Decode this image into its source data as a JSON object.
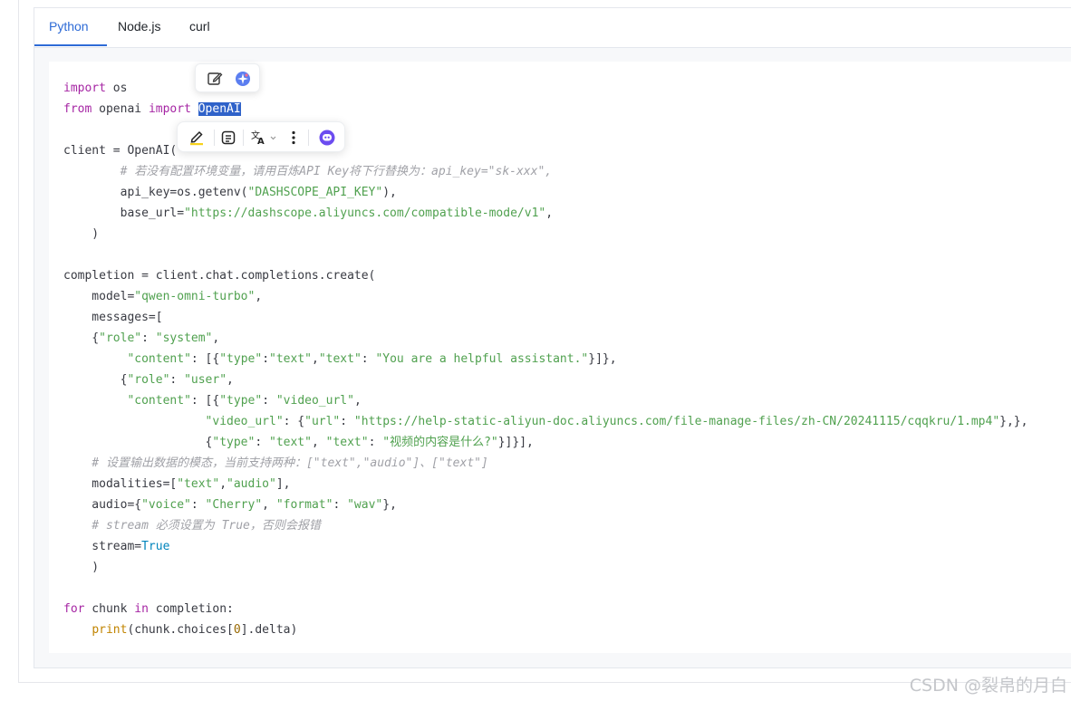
{
  "tabs": [
    {
      "label": "Python",
      "active": true
    },
    {
      "label": "Node.js",
      "active": false
    },
    {
      "label": "curl",
      "active": false
    }
  ],
  "code": {
    "l1_kw": "import",
    "l1_rest": " os",
    "l2_kw1": "from",
    "l2_mid": " openai ",
    "l2_kw2": "import",
    "l2_sp": " ",
    "l2_sel": "OpenAI",
    "l4": "client = OpenAI(",
    "l5_comment": "        # 若没有配置环境变量，请用百炼API Key将下行替换为：api_key=\"sk-xxx\",",
    "l6_pre": "        api_key=os.getenv(",
    "l6_str": "\"DASHSCOPE_API_KEY\"",
    "l6_post": "),",
    "l7_pre": "        base_url=",
    "l7_str": "\"https://dashscope.aliyuncs.com/compatible-mode/v1\"",
    "l7_post": ",",
    "l8": "    )",
    "l10": "completion = client.chat.completions.create(",
    "l11_pre": "    model=",
    "l11_str": "\"qwen-omni-turbo\"",
    "l11_post": ",",
    "l12": "    messages=[",
    "l13_pre": "    {",
    "l13_k": "\"role\"",
    "l13_mid": ": ",
    "l13_v": "\"system\"",
    "l13_post": ",",
    "l14_pre": "         ",
    "l14_k": "\"content\"",
    "l14_a": ": [{",
    "l14_t1": "\"type\"",
    "l14_b": ":",
    "l14_t2": "\"text\"",
    "l14_c": ",",
    "l14_t3": "\"text\"",
    "l14_d": ": ",
    "l14_t4": "\"You are a helpful assistant.\"",
    "l14_e": "}]},",
    "l15_pre": "        {",
    "l15_k": "\"role\"",
    "l15_mid": ": ",
    "l15_v": "\"user\"",
    "l15_post": ",",
    "l16_pre": "         ",
    "l16_k": "\"content\"",
    "l16_a": ": [{",
    "l16_t1": "\"type\"",
    "l16_b": ": ",
    "l16_t2": "\"video_url\"",
    "l16_c": ",",
    "l17_pre": "                    ",
    "l17_k": "\"video_url\"",
    "l17_a": ": {",
    "l17_t1": "\"url\"",
    "l17_b": ": ",
    "l17_t2": "\"https://help-static-aliyun-doc.aliyuncs.com/file-manage-files/zh-CN/20241115/cqqkru/1.mp4\"",
    "l17_c": "},},",
    "l18_pre": "                    {",
    "l18_t1": "\"type\"",
    "l18_b": ": ",
    "l18_t2": "\"text\"",
    "l18_c": ", ",
    "l18_t3": "\"text\"",
    "l18_d": ": ",
    "l18_t4": "\"视频的内容是什么?\"",
    "l18_e": "}]}],",
    "l19_comment": "    # 设置输出数据的模态，当前支持两种：[\"text\",\"audio\"]、[\"text\"]",
    "l20_pre": "    modalities=[",
    "l20_s1": "\"text\"",
    "l20_c": ",",
    "l20_s2": "\"audio\"",
    "l20_post": "],",
    "l21_pre": "    audio={",
    "l21_s1": "\"voice\"",
    "l21_a": ": ",
    "l21_s2": "\"Cherry\"",
    "l21_b": ", ",
    "l21_s3": "\"format\"",
    "l21_c": ": ",
    "l21_s4": "\"wav\"",
    "l21_post": "},",
    "l22_comment": "    # stream 必须设置为 True，否则会报错",
    "l23_pre": "    stream=",
    "l23_true": "True",
    "l24": "    )",
    "l26_kw1": "for",
    "l26_a": " chunk ",
    "l26_kw2": "in",
    "l26_b": " completion:",
    "l27_pre": "    ",
    "l27_fn": "print",
    "l27_a": "(chunk.choices[",
    "l27_num": "0",
    "l27_b": "].delta)"
  },
  "watermark": "CSDN @裂帛的月白",
  "colors": {
    "accent": "#2e6bd6",
    "selection": "#2f62c9",
    "ai_badge": "#6c4cf0"
  }
}
